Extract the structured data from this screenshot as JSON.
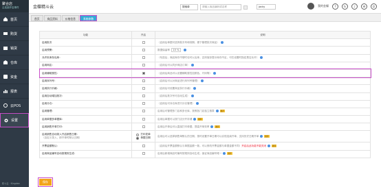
{
  "app": {
    "logo_title": "聚合店",
    "logo_sub": "云连锁开店事件",
    "header_title": "金蝶精斗云"
  },
  "search": {
    "select": "搜索单",
    "placeholder": "请输入商品编码或名称",
    "user_select": "jacky"
  },
  "header": {
    "user_name": "我的金蝶",
    "help": "?"
  },
  "sidebar": {
    "items": [
      {
        "label": "首页"
      },
      {
        "label": "购货"
      },
      {
        "label": "销货"
      },
      {
        "label": "仓库"
      },
      {
        "label": "资金"
      },
      {
        "label": "报表"
      },
      {
        "label": "云POS"
      },
      {
        "label": "设置"
      }
    ],
    "footer": "精斗云 · Kingdee"
  },
  "tabs": [
    {
      "label": "首页"
    },
    {
      "label": "商品资料"
    },
    {
      "label": "价格信息"
    },
    {
      "label": "系统参数"
    }
  ],
  "table": {
    "headers": [
      "功能",
      "开启",
      "说明"
    ],
    "rows": [
      {
        "feature": "启用批次",
        "checked": false,
        "desc": "（启用后单据可选择批次号和效期，便于管理批次商品）"
      },
      {
        "feature": "启用预警：",
        "checked": false,
        "desc": "数据保留率",
        "pct": "15 %"
      },
      {
        "feature": "允许负库存出库：",
        "checked": false,
        "desc": "（勾选后，商品库存不够时也可以出库，否则保存提示库存不足，可在设置时指定是否允许）"
      },
      {
        "feature": "启用网店：",
        "checked": false,
        "desc": "（启用后可以同步网店订单）"
      },
      {
        "feature": "启用辅助属性：",
        "checked": true,
        "desc": "（启用后商品可以设置辅助属性如颜色、尺码等）"
      },
      {
        "feature": "启用序列号：",
        "checked": false,
        "desc": "（启用后可以对商品进行序列号管理）"
      },
      {
        "feature": "启用执行价格：",
        "checked": false,
        "desc": "（启用后可设置商品执行价格）"
      },
      {
        "feature": "启用自动增加批次：",
        "checked": false,
        "desc": "（启用后批次号可自动生成）"
      },
      {
        "feature": "启用分仓：",
        "checked": false,
        "desc": "（启用后可对仓库进行分仓管理）"
      },
      {
        "feature": "启用管理：",
        "checked": false,
        "desc": "启用后可管理多门店和多仓库，按照各门店独立核算",
        "badge": "推荐"
      },
      {
        "feature": "启用单据多单据库：",
        "checked": false,
        "desc": "启用后单据可以按门店分开存储",
        "badge": "推荐"
      },
      {
        "feature": "启用销售开单打印：",
        "checked": false,
        "desc": "启用后开单后可以直接打印单据，提高开单效率",
        "badge": "推荐"
      },
      {
        "feature": "启用销售自动录入开启销售日期：",
        "sub": "（自定义录入，即开单时默认日期）",
        "radio1": "打印发单",
        "radio2": "单据日期",
        "radio_selected": 2,
        "desc": "启用后可以选择销售单默认的日期，按时设置开单日期可以实现连续开单，支持历史日期开单",
        "badge": "推荐"
      },
      {
        "feature": "开票金额默认：",
        "checked": false,
        "desc": "（启用后开票金额默认与单据金额一致，可以修改开票金额与单据金额不同）",
        "red": "开启后此功能不能关闭",
        "badge": "推荐"
      },
      {
        "feature": "启用商品编号自动按规则生成：",
        "checked": false,
        "desc": "启用后新增商品时编号按规则自动生成，保证商品编号唯一",
        "badge": "推荐"
      }
    ]
  },
  "actions": {
    "save_label": "保存"
  }
}
